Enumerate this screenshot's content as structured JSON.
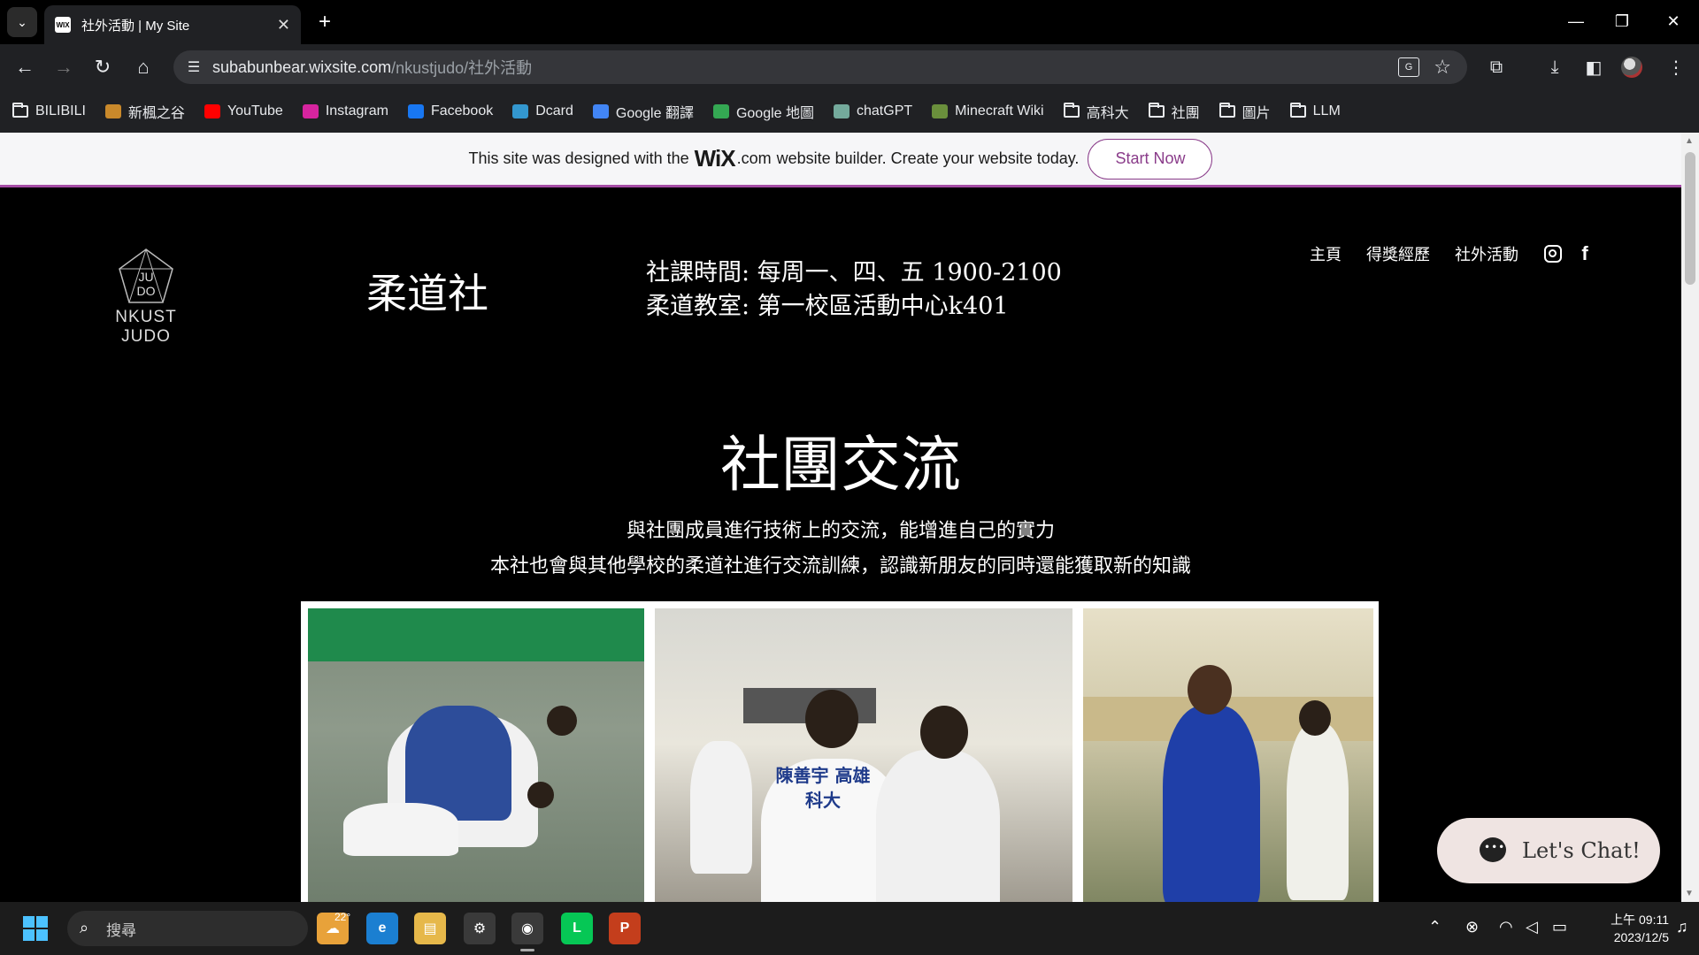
{
  "browser": {
    "tab_title": "社外活動 | My Site",
    "favicon_text": "WIX",
    "url_host": "subabunbear.wixsite.com",
    "url_path": "/nkustjudo/社外活動"
  },
  "bookmarks": [
    {
      "label": "BILIBILI",
      "icon": "folder-icon",
      "type": "folder"
    },
    {
      "label": "新楓之谷",
      "icon": "maplestory-icon",
      "color": "#c9892b"
    },
    {
      "label": "YouTube",
      "icon": "youtube-icon",
      "color": "#ff0000"
    },
    {
      "label": "Instagram",
      "icon": "instagram-icon",
      "color": "#d6249f"
    },
    {
      "label": "Facebook",
      "icon": "facebook-icon",
      "color": "#1877f2"
    },
    {
      "label": "Dcard",
      "icon": "dcard-icon",
      "color": "#3397cf"
    },
    {
      "label": "Google 翻譯",
      "icon": "google-translate-icon",
      "color": "#4285f4"
    },
    {
      "label": "Google 地圖",
      "icon": "google-maps-icon",
      "color": "#34a853"
    },
    {
      "label": "chatGPT",
      "icon": "chatgpt-icon",
      "color": "#74aa9c"
    },
    {
      "label": "Minecraft Wiki",
      "icon": "minecraft-icon",
      "color": "#6a8f3c"
    },
    {
      "label": "高科大",
      "icon": "folder-icon",
      "type": "folder"
    },
    {
      "label": "社團",
      "icon": "folder-icon",
      "type": "folder"
    },
    {
      "label": "圖片",
      "icon": "folder-icon",
      "type": "folder"
    },
    {
      "label": "LLM",
      "icon": "folder-icon",
      "type": "folder"
    }
  ],
  "wix_banner": {
    "prefix": "This site was designed with the",
    "logo": "WiX",
    "dotcom": ".com",
    "suffix": "website builder. Create your website today.",
    "button": "Start Now",
    "accent": "#a64ca6"
  },
  "site": {
    "logo_top": "JU",
    "logo_bottom": "DO",
    "logo_text": "NKUST JUDO",
    "club_name": "柔道社",
    "schedule": "社課時間: 每周一、四、五 1900-2100",
    "classroom": "柔道教室: 第一校區活動中心k401",
    "nav": [
      "主頁",
      "得獎經歷",
      "社外活動"
    ],
    "section_title": "社團交流",
    "desc_line1": "與社團成員進行技術上的交流，能增進自己的實力",
    "desc_line2": "本社也會與其他學校的柔道社進行交流訓練，認識新朋友的同時還能獲取新的知識",
    "jersey_text": "陳善宇 高雄科大",
    "chat_label": "Let's Chat!"
  },
  "taskbar": {
    "search_placeholder": "搜尋",
    "weather": "22°",
    "time": "上午 09:11",
    "date": "2023/12/5"
  }
}
